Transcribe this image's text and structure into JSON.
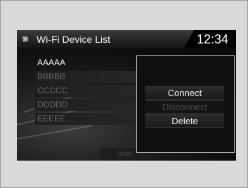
{
  "header": {
    "title": "Wi-Fi Device List",
    "icon": "gear-icon",
    "clock": "12:34"
  },
  "device_list": {
    "items": [
      {
        "label": "AAAAA",
        "selected": true
      },
      {
        "label": "BBBBB",
        "selected": false
      },
      {
        "label": "CCCCC",
        "selected": false
      },
      {
        "label": "DDDDD",
        "selected": false
      },
      {
        "label": "EEEEE",
        "selected": false
      }
    ]
  },
  "scan_button": {
    "label": "Scan"
  },
  "popup_menu": {
    "items": [
      {
        "label": "Connect",
        "enabled": true
      },
      {
        "label": "Disconnect",
        "enabled": false
      },
      {
        "label": "Delete",
        "enabled": true
      }
    ]
  },
  "colors": {
    "page_background": "#d9d9d9",
    "screen_background": "#0d0d0d",
    "enabled_text": "#f2f2f2",
    "disabled_text": "#4b4b4b"
  }
}
